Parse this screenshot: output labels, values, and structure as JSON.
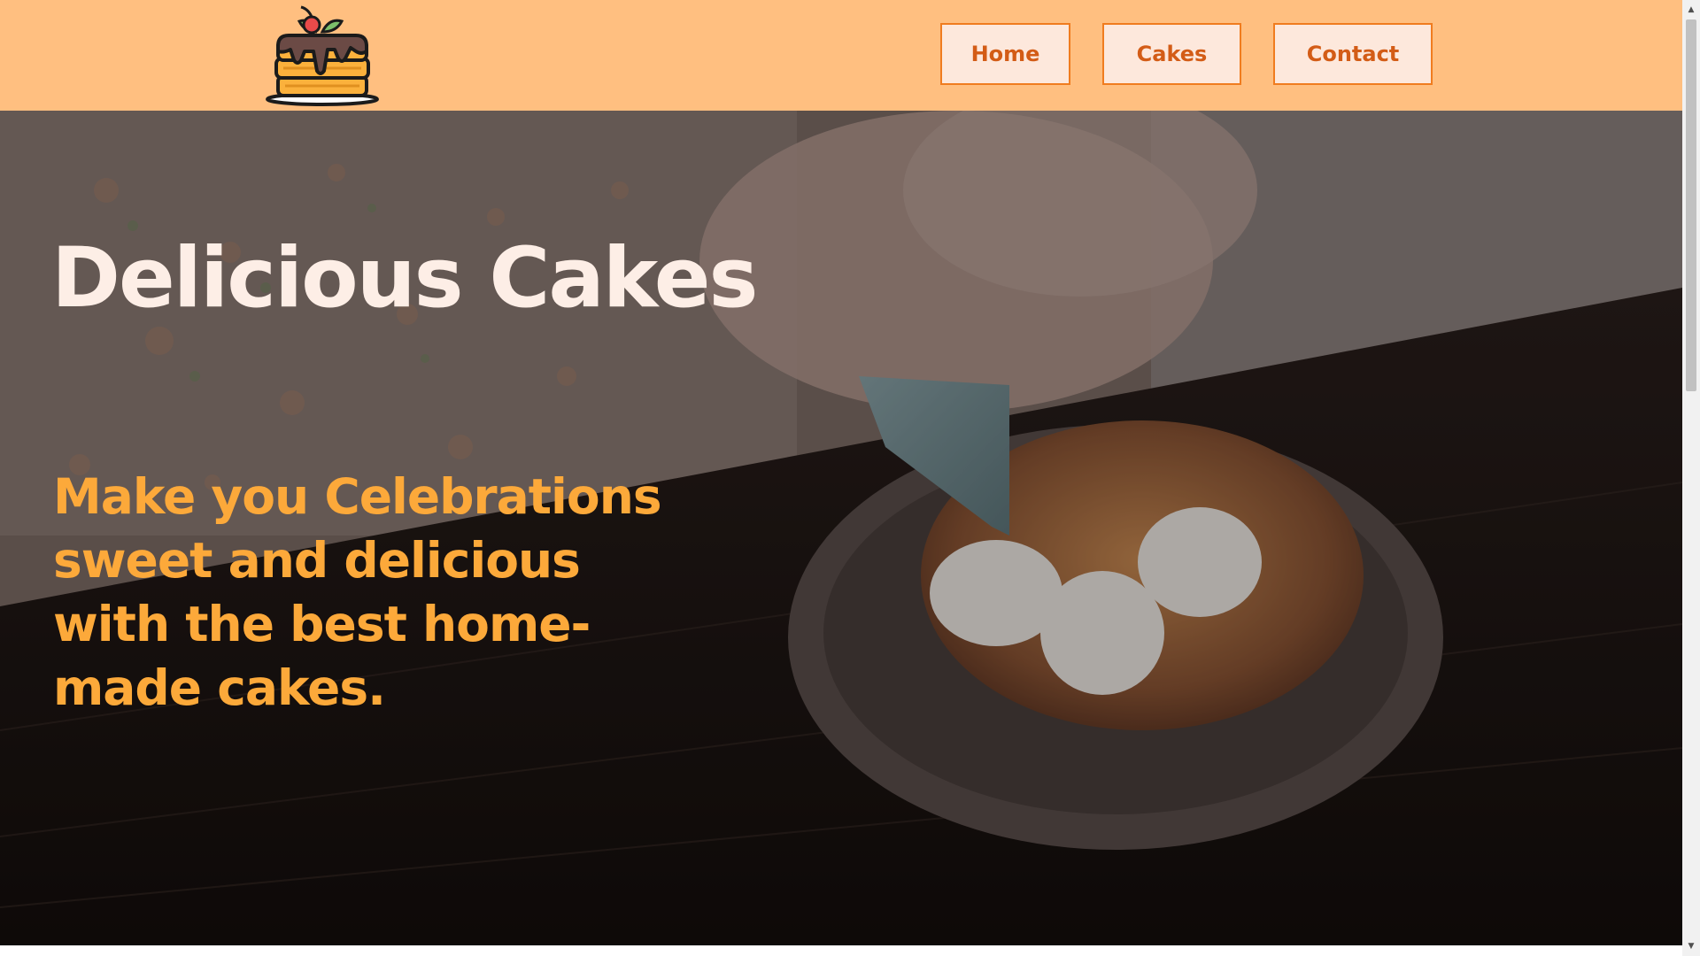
{
  "header": {
    "logo_icon": "layered-cake-with-cherry-icon",
    "nav": [
      {
        "label": "Home"
      },
      {
        "label": "Cakes"
      },
      {
        "label": "Contact"
      }
    ]
  },
  "hero": {
    "title": "Delicious Cakes",
    "tagline": "Make you Celebrations sweet and delicious with the best home-made cakes.",
    "background_image": "piping-cream-onto-cake-photo"
  },
  "scrollbar": {
    "up_icon": "scroll-up-arrow-icon",
    "down_icon": "scroll-down-arrow-icon"
  },
  "colors": {
    "header_bg": "#ffbf80",
    "nav_border": "#f07c1f",
    "nav_bg": "#fde8dc",
    "nav_text": "#d35c16",
    "title_text": "#fdeee6",
    "tagline_text": "#fca93a"
  }
}
